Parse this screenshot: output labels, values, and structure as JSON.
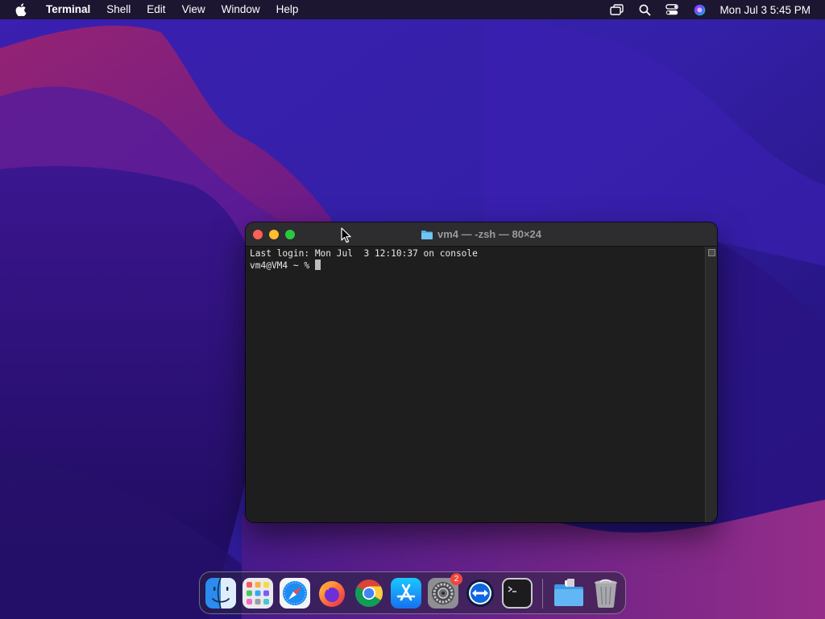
{
  "menubar": {
    "app_name": "Terminal",
    "menus": [
      "Shell",
      "Edit",
      "View",
      "Window",
      "Help"
    ],
    "clock": "Mon Jul 3  5:45 PM",
    "status_icons": [
      "screen-mirroring-icon",
      "spotlight-search-icon",
      "control-center-icon",
      "siri-icon"
    ]
  },
  "terminal": {
    "title": "vm4 — -zsh — 80×24",
    "lines": [
      "Last login: Mon Jul  3 12:10:37 on console",
      "vm4@VM4 ~ % "
    ]
  },
  "dock": {
    "apps": [
      {
        "name": "finder",
        "icon": "finder-icon"
      },
      {
        "name": "launchpad",
        "icon": "launchpad-icon"
      },
      {
        "name": "safari",
        "icon": "safari-icon"
      },
      {
        "name": "firefox",
        "icon": "firefox-icon"
      },
      {
        "name": "chrome",
        "icon": "chrome-icon"
      },
      {
        "name": "app-store",
        "icon": "app-store-icon"
      },
      {
        "name": "system-preferences",
        "icon": "system-preferences-icon",
        "badge": "2"
      },
      {
        "name": "teamviewer",
        "icon": "teamviewer-icon"
      },
      {
        "name": "terminal",
        "icon": "terminal-icon"
      },
      {
        "name": "downloads-folder",
        "icon": "folder-icon"
      },
      {
        "name": "trash",
        "icon": "trash-icon"
      }
    ]
  },
  "colors": {
    "close": "#fe5f57",
    "minimize": "#febc2e",
    "maximize": "#28c840",
    "terminal_bg": "#1e1e1e",
    "badge": "#f2453d"
  }
}
